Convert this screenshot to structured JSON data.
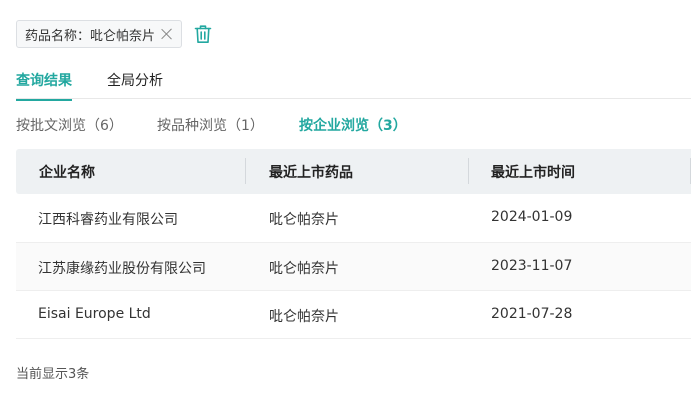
{
  "filter": {
    "chip_label": "药品名称：吡仑帕奈片"
  },
  "main_tabs": [
    {
      "label": "查询结果",
      "active": true
    },
    {
      "label": "全局分析",
      "active": false
    }
  ],
  "sub_tabs": [
    {
      "label": "按批文浏览（6）",
      "active": false
    },
    {
      "label": "按品种浏览（1）",
      "active": false
    },
    {
      "label": "按企业浏览（3）",
      "active": true
    }
  ],
  "table": {
    "headers": [
      "企业名称",
      "最近上市药品",
      "最近上市时间"
    ],
    "rows": [
      [
        "江西科睿药业有限公司",
        "吡仑帕奈片",
        "2024-01-09"
      ],
      [
        "江苏康缘药业股份有限公司",
        "吡仑帕奈片",
        "2023-11-07"
      ],
      [
        "Eisai Europe Ltd",
        "吡仑帕奈片",
        "2021-07-28"
      ]
    ]
  },
  "footer": {
    "count_text": "当前显示3条"
  },
  "colors": {
    "accent": "#23a8a0",
    "header_bg": "#eef1f3"
  }
}
